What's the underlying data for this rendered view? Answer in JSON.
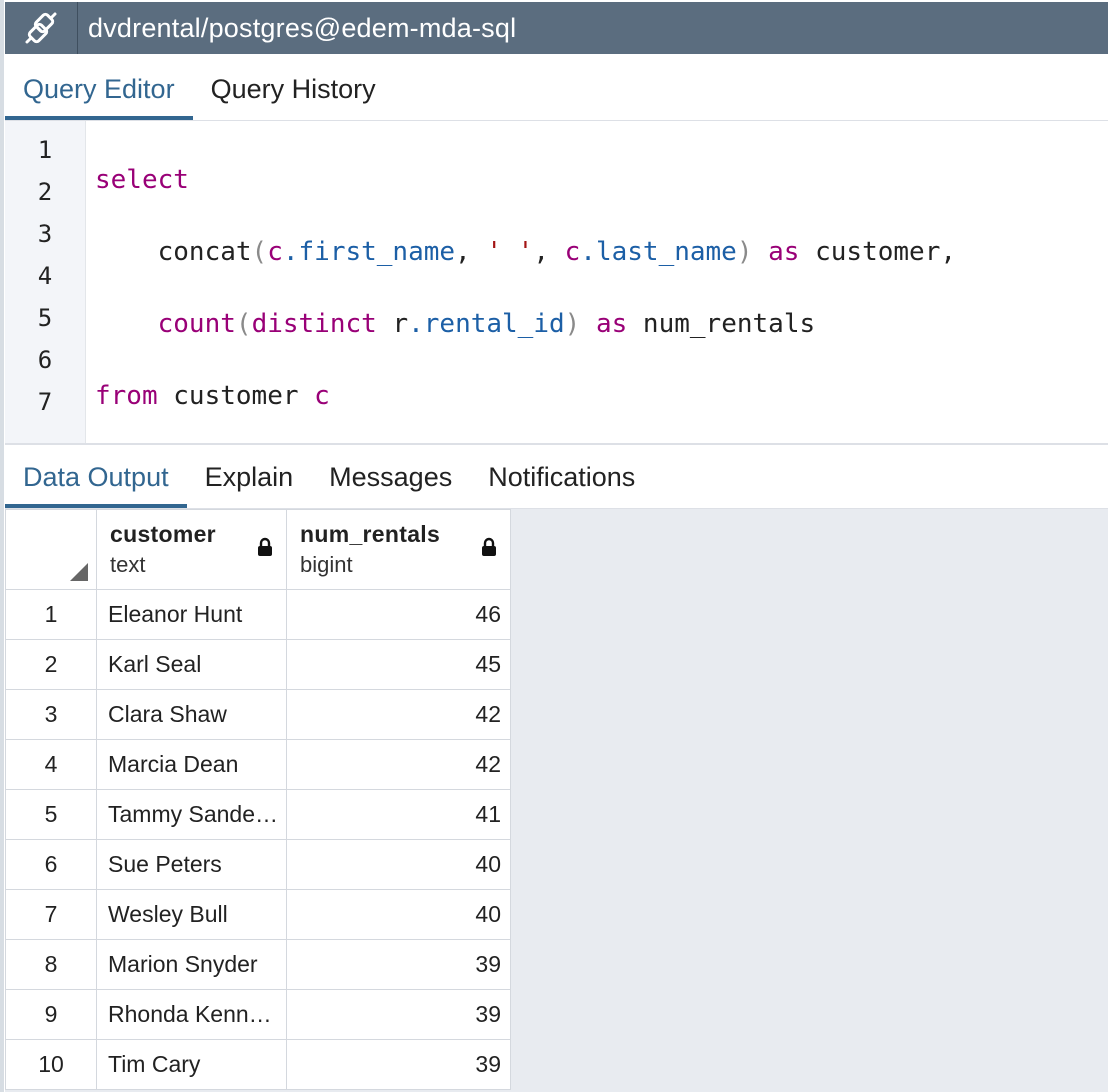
{
  "title_bar": {
    "connection_title": "dvdrental/postgres@edem-mda-sql",
    "icon": "connection-plug-icon"
  },
  "query_tabs": [
    {
      "label": "Query Editor",
      "active": true
    },
    {
      "label": "Query History",
      "active": false
    }
  ],
  "editor": {
    "line_numbers": [
      "1",
      "2",
      "3",
      "4",
      "5",
      "6",
      "7"
    ]
  },
  "output_tabs": [
    {
      "label": "Data Output",
      "active": true
    },
    {
      "label": "Explain",
      "active": false
    },
    {
      "label": "Messages",
      "active": false
    },
    {
      "label": "Notifications",
      "active": false
    }
  ],
  "grid": {
    "columns": [
      {
        "name": "customer",
        "type": "text",
        "icon": "lock-icon"
      },
      {
        "name": "num_rentals",
        "type": "bigint",
        "icon": "lock-icon"
      }
    ],
    "rows": [
      {
        "n": "1",
        "customer": "Eleanor Hunt",
        "num_rentals": "46"
      },
      {
        "n": "2",
        "customer": "Karl Seal",
        "num_rentals": "45"
      },
      {
        "n": "3",
        "customer": "Clara Shaw",
        "num_rentals": "42"
      },
      {
        "n": "4",
        "customer": "Marcia Dean",
        "num_rentals": "42"
      },
      {
        "n": "5",
        "customer": "Tammy Sande…",
        "num_rentals": "41"
      },
      {
        "n": "6",
        "customer": "Sue Peters",
        "num_rentals": "40"
      },
      {
        "n": "7",
        "customer": "Wesley Bull",
        "num_rentals": "40"
      },
      {
        "n": "8",
        "customer": "Marion Snyder",
        "num_rentals": "39"
      },
      {
        "n": "9",
        "customer": "Rhonda Kenn…",
        "num_rentals": "39"
      },
      {
        "n": "10",
        "customer": "Tim Cary",
        "num_rentals": "39"
      }
    ]
  },
  "colors": {
    "title_bar": "#5b6d7f",
    "accent": "#326690",
    "keyword": "#990077",
    "field": "#1c5fa6",
    "string": "#a31515"
  }
}
